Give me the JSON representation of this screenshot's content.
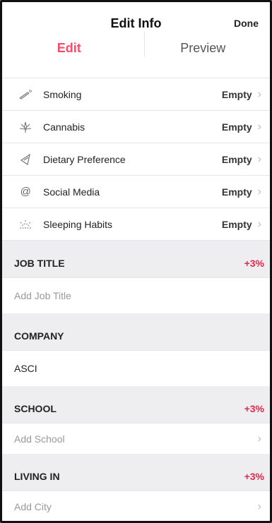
{
  "nav": {
    "title": "Edit Info",
    "done_label": "Done"
  },
  "tabs": [
    {
      "label": "Edit"
    },
    {
      "label": "Preview"
    }
  ],
  "lifestyle": [
    {
      "icon": "smoking-icon",
      "glyph": "✸",
      "label": "Smoking",
      "value": "Empty"
    },
    {
      "icon": "cannabis-icon",
      "glyph": "⚘",
      "label": "Cannabis",
      "value": "Empty"
    },
    {
      "icon": "dietary-icon",
      "glyph": "◁",
      "label": "Dietary Preference",
      "value": "Empty"
    },
    {
      "icon": "at-icon",
      "glyph": "@",
      "label": "Social Media",
      "value": "Empty"
    },
    {
      "icon": "sunrise-icon",
      "glyph": "☀",
      "label": "Sleeping Habits",
      "value": "Empty"
    }
  ],
  "sections": {
    "job_title": {
      "title": "JOB TITLE",
      "boost": "+3%",
      "placeholder": "Add Job Title"
    },
    "company": {
      "title": "COMPANY",
      "value": "ASCI"
    },
    "school": {
      "title": "SCHOOL",
      "boost": "+3%",
      "placeholder": "Add School"
    },
    "living_in": {
      "title": "LIVING IN",
      "boost": "+3%",
      "placeholder": "Add City"
    }
  },
  "chevron": "›",
  "colors": {
    "accent": "#fd4a6b",
    "boost": "#e8264b",
    "section_bg": "#eeeef1"
  }
}
